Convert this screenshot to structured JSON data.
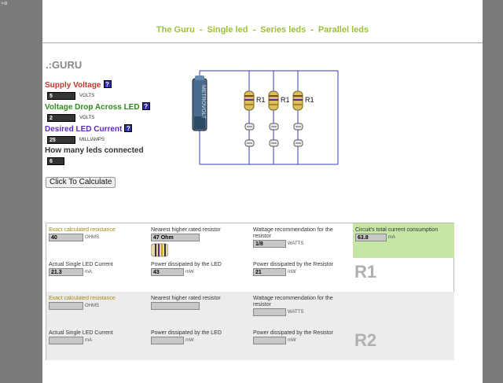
{
  "corner_glyph": "»ø",
  "nav": {
    "items": [
      "The Guru",
      "Single led",
      "Series leds",
      "Parallel leds"
    ],
    "separator": "-"
  },
  "guru_title": ".:GURU",
  "form": {
    "supply_voltage": {
      "label": "Supply Voltage",
      "value": "5",
      "unit": "VOLTS",
      "color": "#c0392b"
    },
    "voltage_drop": {
      "label": "Voltage Drop Across LED",
      "value": "2",
      "unit": "VOLTS",
      "color": "#2e8b1e"
    },
    "led_current": {
      "label": "Desired LED Current",
      "value": "25",
      "unit": "MILLIAMPS",
      "color": "#5a2bc0"
    },
    "led_count": {
      "label": "How many leds connected",
      "value": "6",
      "color": "#333333"
    },
    "help_glyph": "?",
    "calculate_button": "Click To Calculate"
  },
  "diagram": {
    "battery_text": "METROVOLT",
    "resistor_label": "R1"
  },
  "results": {
    "r1": {
      "exact_resistance": {
        "label": "Exact calculated resistance",
        "value": "40",
        "unit": "OHMS"
      },
      "nearest_resistor": {
        "label": "Nearest higher rated resistor",
        "value": "47 Ohm"
      },
      "wattage": {
        "label": "Wattage recommendation for the resistor",
        "value": "1/8",
        "unit": "WATTS"
      },
      "total_current": {
        "label": "Circuit's total current consumption",
        "value": "63.8",
        "unit": "mA"
      },
      "single_led_current": {
        "label": "Actual Single LED Current",
        "value": "21.3",
        "unit": "mA"
      },
      "power_led": {
        "label": "Power dissipated by the LED",
        "value": "43",
        "unit": "mW"
      },
      "power_resistor": {
        "label": "Power dissipated by the Resistor",
        "value": "21",
        "unit": "mW"
      },
      "tag": "R1"
    },
    "r2": {
      "exact_resistance": {
        "label": "Exact calculated resistance",
        "value": "",
        "unit": "OHMS"
      },
      "nearest_resistor": {
        "label": "Nearest higher rated resistor",
        "value": ""
      },
      "wattage": {
        "label": "Wattage recommendation for the resistor",
        "value": "",
        "unit": "WATTS"
      },
      "single_led_current": {
        "label": "Actual Single LED Current",
        "value": "",
        "unit": "mA"
      },
      "power_led": {
        "label": "Power dissipated by the LED",
        "value": "",
        "unit": "mW"
      },
      "power_resistor": {
        "label": "Power dissipated by the Resistor",
        "value": "",
        "unit": "mW"
      },
      "tag": "R2"
    }
  },
  "colors": {
    "nav": "#9ac03b",
    "exact_label": "#a08a10",
    "total_current_bg": "#c6e6a6",
    "r2_row_bg": "#ececec"
  }
}
